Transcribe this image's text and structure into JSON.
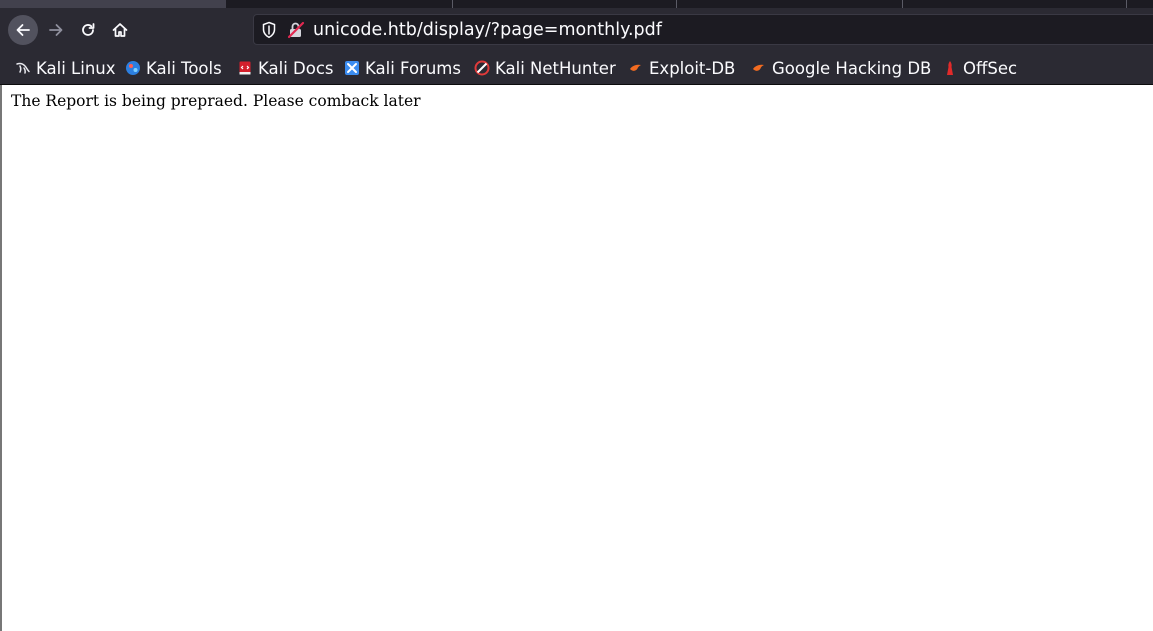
{
  "browser": {
    "url": "unicode.htb/display/?page=monthly.pdf",
    "bookmarks": [
      {
        "label": "Kali Linux",
        "icon": "kali-dragon-icon"
      },
      {
        "label": "Kali Tools",
        "icon": "kali-tools-icon"
      },
      {
        "label": "Kali Docs",
        "icon": "kali-docs-icon"
      },
      {
        "label": "Kali Forums",
        "icon": "kali-forums-icon"
      },
      {
        "label": "Kali NetHunter",
        "icon": "kali-nethunter-icon"
      },
      {
        "label": "Exploit-DB",
        "icon": "exploit-db-icon"
      },
      {
        "label": "Google Hacking DB",
        "icon": "ghdb-icon"
      },
      {
        "label": "OffSec",
        "icon": "offsec-icon"
      }
    ]
  },
  "page": {
    "message": "The Report is being prepraed. Please comback later"
  },
  "colors": {
    "chrome_bg": "#2b2a33",
    "urlbar_bg": "#1c1b22",
    "page_bg": "#ffffff"
  }
}
